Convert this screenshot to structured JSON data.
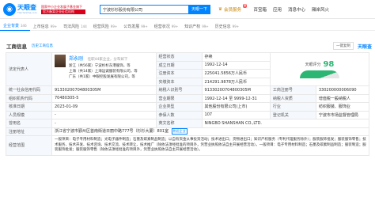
{
  "header": {
    "logo_name": "天眼查",
    "logo_sub": "TianYanCha.com",
    "promo_line1": "国家中小企业发展子基金旗下",
    "promo_line2": "官方备案企业征信机构",
    "search_value": "宁波杉杉股份有限公司",
    "search_button": "天眼一下",
    "nav": [
      "会员服务",
      "百宝箱",
      "应用",
      "消息中心",
      "厢岸风火"
    ],
    "vip_badge": "新"
  },
  "tabs": [
    {
      "label": "企业背景",
      "count": "346"
    },
    {
      "label": "上市信息",
      "count": "99+"
    },
    {
      "label": "司法风险",
      "count": "144"
    },
    {
      "label": "经营风险",
      "count": "99+"
    },
    {
      "label": "公司发展",
      "count": "99+"
    },
    {
      "label": "经营状况",
      "count": "99+"
    },
    {
      "label": "知识产权",
      "count": "99+"
    },
    {
      "label": "历史信息",
      "count": "99+"
    }
  ],
  "section": {
    "title": "工商信息",
    "link": "历史工商信息",
    "actions": [
      "一键复制",
      "天眼查"
    ]
  },
  "info": {
    "legal_rep_label": "法定代表人",
    "legal_rep_name": "郑永刚",
    "legal_rep_note": "任职44家企业，分布如下",
    "legal_rep_lines": [
      "浙江（共56家）宁波杉杉东港服饰，等",
      "上海（共14家）上海运诚服装有限公司，等",
      "广东（共1家）中眼控股发展有限公司，等"
    ],
    "status_label": "经营状态",
    "status_value": "存续",
    "established_label": "成立日期",
    "established_value": "1992-12-14",
    "registered_capital_label": "注册资本",
    "registered_capital_value": "225041.5856万人民币",
    "paid_capital_label": "实缴资本",
    "paid_capital_value": "214291.9878万人民币",
    "score_label": "天眼评分",
    "score_value": "98",
    "uscc_label": "统一社会信用代码",
    "uscc_value": "91330200704800305M",
    "tax_id_label": "纳税人识别号",
    "tax_id_value": "91330200704800305M",
    "reg_no_label": "工商注册号",
    "reg_no_value": "330200000006090",
    "org_code_label": "组织机构代码",
    "org_code_value": "70480305-5",
    "term_label": "营业期限",
    "term_value": "1992-12-14 至 9999-12-31",
    "taxpayer_label": "纳税人资质",
    "taxpayer_value": "增值税一般纳税人",
    "approval_label": "核准日期",
    "approval_value": "2023-01-09",
    "type_label": "企业类型",
    "type_value": "其他股份有限公司(上市)",
    "industry_label": "行业",
    "industry_value": "纺织服装、服饰业",
    "staff_label": "人员规模",
    "staff_value": "-",
    "insured_label": "参保人数",
    "insured_value": "107",
    "authority_label": "登记机关",
    "authority_value": "宁波市市场监督管理局",
    "used_name_label": "曾用名",
    "used_name_value": "-",
    "english_label": "英文名称",
    "english_value": "NINGBO SHANSHAN CO.,LTD.",
    "address_label": "注册地址",
    "address_value": "浙江省宁波市鄞州区首南街道日丽中路777号（杉杉大厦）801室",
    "address_chip": "附近企业",
    "scope_label": "经营范围",
    "scope_value": "一般项目：电子专用材料制造；光电子器件制造；石墨及碳素制品制造；以自有资金从事投资活动；技术进出口；货物进出口；知识产权服务（专利代理服务除外）；服装服饰批发；服装服饰零售；技术服务、技术开发、技术咨询、技术交流、技术转让、技术推广（除依法须经批准的项目外，凭营业执照依法自主开展经营活动）。一般项目：电子专用材料制造；石墨及碳素制品制造；服装制造；服装服饰批发；服装服饰零售（除依法须经批准的项目外，凭营业执照依法自主开展经营活动）。"
  },
  "colors": {
    "brand": "#0084ff",
    "score": "#2bb673",
    "label_bg": "#f5f8fc"
  }
}
